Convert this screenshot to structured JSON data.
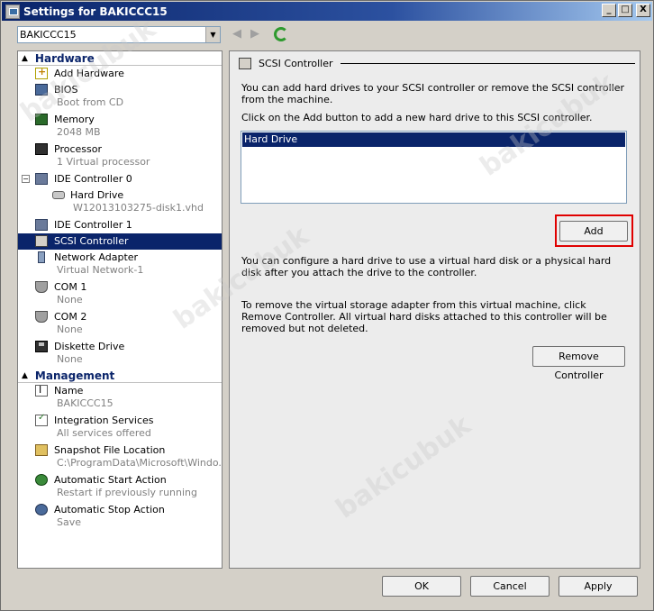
{
  "window": {
    "title": "Settings for BAKICCC15",
    "minimize": "_",
    "maximize": "□",
    "close": "X"
  },
  "vm_selector": {
    "value": "BAKICCC15"
  },
  "hardware": {
    "header": "Hardware",
    "items": [
      {
        "label": "Add Hardware",
        "sub": ""
      },
      {
        "label": "BIOS",
        "sub": "Boot from CD"
      },
      {
        "label": "Memory",
        "sub": "2048 MB"
      },
      {
        "label": "Processor",
        "sub": "1 Virtual processor"
      },
      {
        "label": "IDE Controller 0",
        "sub": ""
      },
      {
        "label": "Hard Drive",
        "sub": "W12013103275-disk1.vhd"
      },
      {
        "label": "IDE Controller 1",
        "sub": ""
      },
      {
        "label": "SCSI Controller",
        "sub": ""
      },
      {
        "label": "Network Adapter",
        "sub": "Virtual Network-1"
      },
      {
        "label": "COM 1",
        "sub": "None"
      },
      {
        "label": "COM 2",
        "sub": "None"
      },
      {
        "label": "Diskette Drive",
        "sub": "None"
      }
    ]
  },
  "management": {
    "header": "Management",
    "items": [
      {
        "label": "Name",
        "sub": "BAKICCC15"
      },
      {
        "label": "Integration Services",
        "sub": "All services offered"
      },
      {
        "label": "Snapshot File Location",
        "sub": "C:\\ProgramData\\Microsoft\\Windo..."
      },
      {
        "label": "Automatic Start Action",
        "sub": "Restart if previously running"
      },
      {
        "label": "Automatic Stop Action",
        "sub": "Save"
      }
    ]
  },
  "detail": {
    "title": "SCSI Controller",
    "intro": "You can add hard drives to your SCSI controller or remove the SCSI controller from the machine.",
    "instruction": "Click on the Add button to add a new hard drive to this SCSI controller.",
    "list_items": [
      "Hard Drive"
    ],
    "add_label": "Add",
    "configure_text": "You can configure a hard drive to use a virtual hard disk or a physical hard disk after you attach the drive to the controller.",
    "remove_text": "To remove the virtual storage adapter from this virtual machine, click Remove Controller. All virtual hard disks attached to this controller will be removed but not deleted.",
    "remove_label": "Remove Controller"
  },
  "footer": {
    "ok": "OK",
    "cancel": "Cancel",
    "apply": "Apply"
  },
  "watermark": "bakicubuk"
}
